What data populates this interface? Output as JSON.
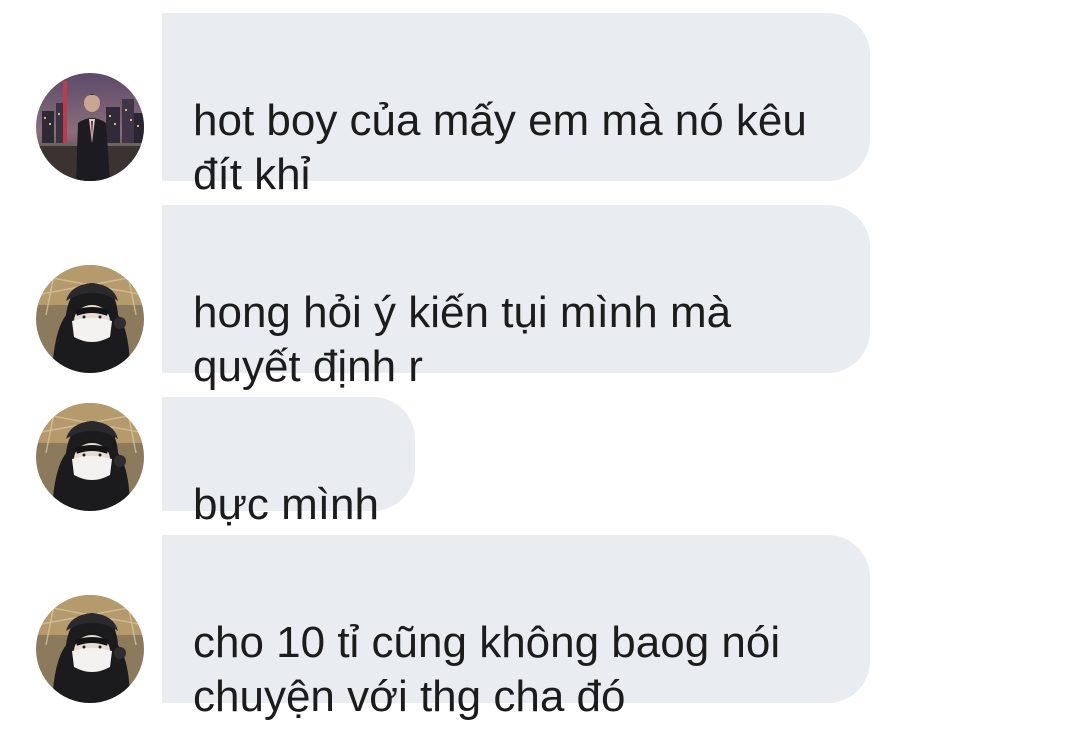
{
  "messages": [
    {
      "text": "hot boy của mấy em mà nó kêu\nđít khỉ",
      "avatar": "city-night-avatar"
    },
    {
      "text": "hong hỏi ý kiến tụi mình mà\nquyết định r",
      "avatar": "hooded-masked-avatar"
    },
    {
      "text": "bực mình",
      "avatar": "hooded-masked-avatar"
    },
    {
      "text": "cho 10 tỉ cũng không baog nói\nchuyện với thg cha đó",
      "avatar": "hooded-masked-avatar"
    }
  ],
  "colors": {
    "bubble": "#e9edf1",
    "text": "#1c1c1c",
    "background": "#ffffff"
  }
}
